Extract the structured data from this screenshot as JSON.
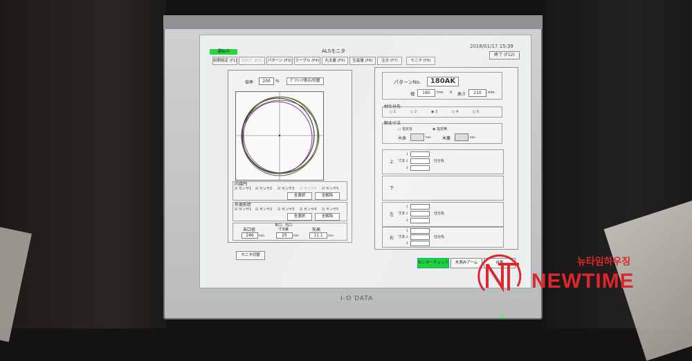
{
  "window": {
    "status": "運転中",
    "title": "ALSモニタ",
    "datetime": "2018/01/17 15:39",
    "exit_label": "終了 (F12)"
  },
  "tabs": [
    {
      "label": "初期設定 (F1)",
      "enabled": true
    },
    {
      "label": "ﾛｽﾀﾝﾌﾟ (F2)",
      "enabled": false
    },
    {
      "label": "パターン (F3)",
      "enabled": true
    },
    {
      "label": "テーブル (F4)",
      "enabled": true
    },
    {
      "label": "丸太量 (F5)",
      "enabled": true
    },
    {
      "label": "生産量 (F6)",
      "enabled": true
    },
    {
      "label": "注文 (F7)",
      "enabled": true
    },
    {
      "label": "モニタ (F8)",
      "enabled": true
    }
  ],
  "left_panel": {
    "magnification_label": "倍率",
    "magnification_value": "200",
    "magnification_unit": "%",
    "graph_toggle": "ｸﾞﾗﾌｨｯｸ表示/切替",
    "inner_section": "内接円",
    "inner_sensors": [
      "センサ1",
      "センサ2",
      "センサ3",
      "センサ4",
      "センサ5"
    ],
    "outer_section": "外周形状",
    "outer_sensors": [
      "センサ1",
      "センサ2",
      "センサ3",
      "センサ4",
      "センサ5"
    ],
    "select_all": "全選択",
    "deselect_all": "全解除",
    "stats": {
      "tip_diameter_label": "末口径",
      "tip_diameter_value": "246",
      "diff_label": "末口、元口\n寸法差",
      "diff_value": "25",
      "bow_label": "矢高",
      "bow_value": "11.1",
      "unit": "mm"
    },
    "monitor_switch": "モニタ切替"
  },
  "right_panel": {
    "pattern_label": "パターンNo.",
    "pattern_value": "180AK",
    "width_label": "幅",
    "width_value": "180",
    "height_label": "高さ",
    "height_value": "210",
    "unit": "mm",
    "split_label": "材仕分先",
    "split_options": [
      "1",
      "2",
      "3",
      "4",
      "5"
    ],
    "split_selected": "3",
    "dimension_label": "野太寸法",
    "dimension_options": [
      "指定有",
      "指定無"
    ],
    "dimension_selected": "指定無",
    "end_label": "木表",
    "back_label": "木裏",
    "sections": [
      {
        "side": "上",
        "kind": "寸法"
      },
      {
        "side": "下",
        "kind": ""
      },
      {
        "side": "左",
        "kind": "寸法"
      },
      {
        "side": "右",
        "kind": "寸法"
      }
    ],
    "row_numbers": [
      "1",
      "2",
      "3"
    ],
    "sort_label": "仕分先"
  },
  "bottom_buttons": {
    "center_check": "センターチェック",
    "alarm": "木測みアーム",
    "cart": "台車"
  },
  "watermark": {
    "korean": "뉴타임하우징",
    "english": "NEWTIME"
  },
  "bezel_brand": "I-O DATA",
  "colors": {
    "run_green": "#27d63a",
    "watermark_red": "#e0262d"
  }
}
